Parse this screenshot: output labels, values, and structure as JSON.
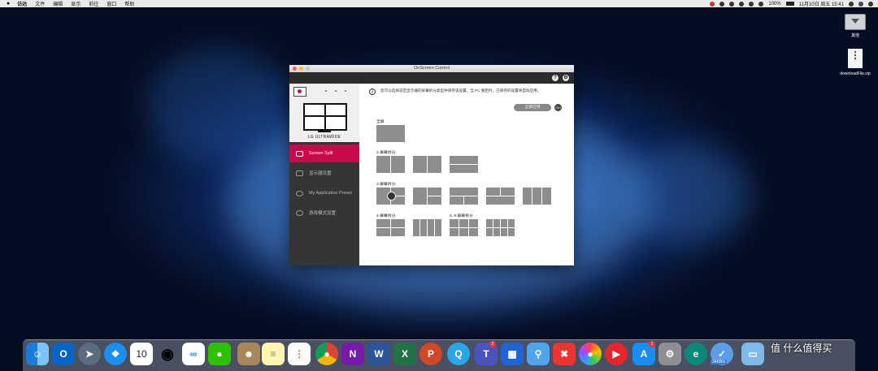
{
  "menubar": {
    "apple": "",
    "app_name": "访达",
    "items": [
      "文件",
      "编辑",
      "显示",
      "前往",
      "窗口",
      "帮助"
    ],
    "battery": "100%",
    "datetime": "11月10日 周五 15:41"
  },
  "desktop": {
    "drive_label": "其他",
    "file_label": "downloadFile.zip"
  },
  "window": {
    "title": "OnScreen Control",
    "help_label": "?",
    "brand": "LG ULTRAWIDE",
    "nav": [
      {
        "label": "Screen Split",
        "active": true
      },
      {
        "label": "显示器设置",
        "active": false
      },
      {
        "label": "My Application Preset",
        "active": false
      },
      {
        "label": "游戏模式设置",
        "active": false
      }
    ],
    "info_text": "您可以选择适定显示器的屏幕拆分类型并保存该设置。当 PC 重启时，已保存的设置将自动应用。",
    "apply_label": "全部应用",
    "apply_icon_label": "Ctrl",
    "sections": {
      "full": "全屏",
      "split2": "2-屏幕拆分",
      "split3": "3-屏幕拆分",
      "split4": "4-屏幕拆分",
      "split6": "6, 8-屏幕拆分"
    }
  },
  "dock": {
    "calendar_day": "10",
    "network_speed": "34KB/s",
    "badge_appstore": "2",
    "badge_teams": "2",
    "watermark": "值 什么值得买"
  }
}
